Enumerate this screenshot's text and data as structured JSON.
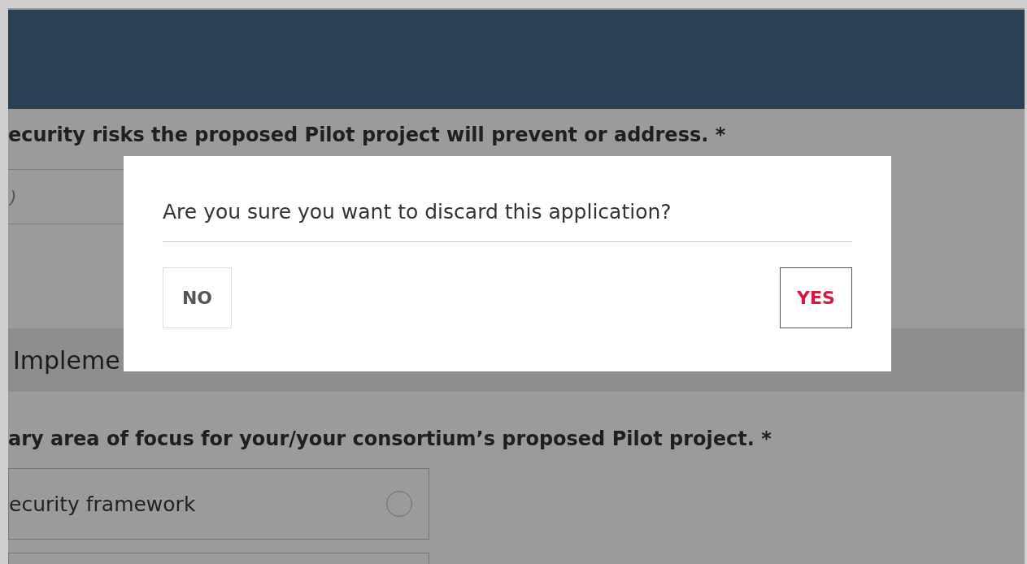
{
  "form": {
    "question_1": {
      "label": "ecurity risks the proposed Pilot project will prevent or address.",
      "required_mark": "*",
      "value": ")"
    },
    "section": {
      "title": "Impleme"
    },
    "question_2": {
      "label": "ary area of focus for your/your consortium’s proposed Pilot project.",
      "required_mark": "*",
      "options": [
        {
          "label": "ecurity framework",
          "selected": false
        }
      ]
    }
  },
  "dialog": {
    "message": "Are you sure you want to discard this application?",
    "buttons": [
      {
        "label": "NO",
        "kind": "default"
      },
      {
        "label": "YES",
        "kind": "danger"
      }
    ]
  }
}
